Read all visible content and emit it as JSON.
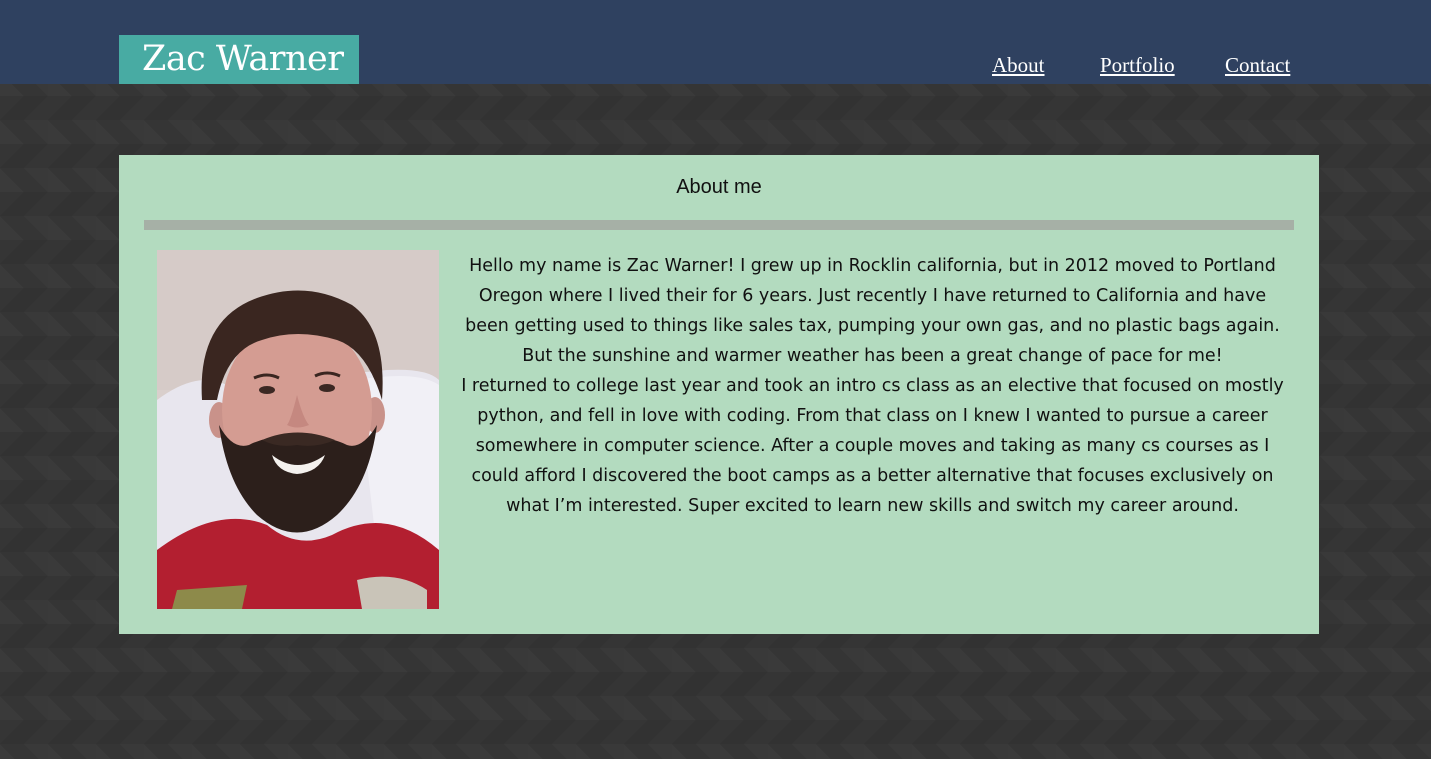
{
  "header": {
    "brand": "Zac Warner",
    "nav": [
      {
        "label": "About"
      },
      {
        "label": "Portfolio"
      },
      {
        "label": "Contact"
      }
    ]
  },
  "about": {
    "title": "About me",
    "paragraphs": [
      "Hello my name is Zac Warner! I grew up in Rocklin california, but in 2012 moved to Portland Oregon where I lived their for 6 years. Just recently I have returned to California and have been getting used to things like sales tax, pumping your own gas, and no plastic bags again. But the sunshine and warmer weather has been a great change of pace for me!",
      "I returned to college last year and took an intro cs class as an elective that focused on mostly python, and fell in love with coding. From that class on I knew I wanted to pursue a career somewhere in computer science. After a couple moves and taking as many cs courses as I could afford I discovered the boot camps as a better alternative that focuses exclusively on what I’m interested. Super excited to learn new skills and switch my career around."
    ]
  },
  "colors": {
    "header_bg": "#2f4160",
    "brand_bg": "#48aba3",
    "panel_bg": "#b3dbbf",
    "divider": "#a6b0a6",
    "page_bg": "#353535"
  }
}
